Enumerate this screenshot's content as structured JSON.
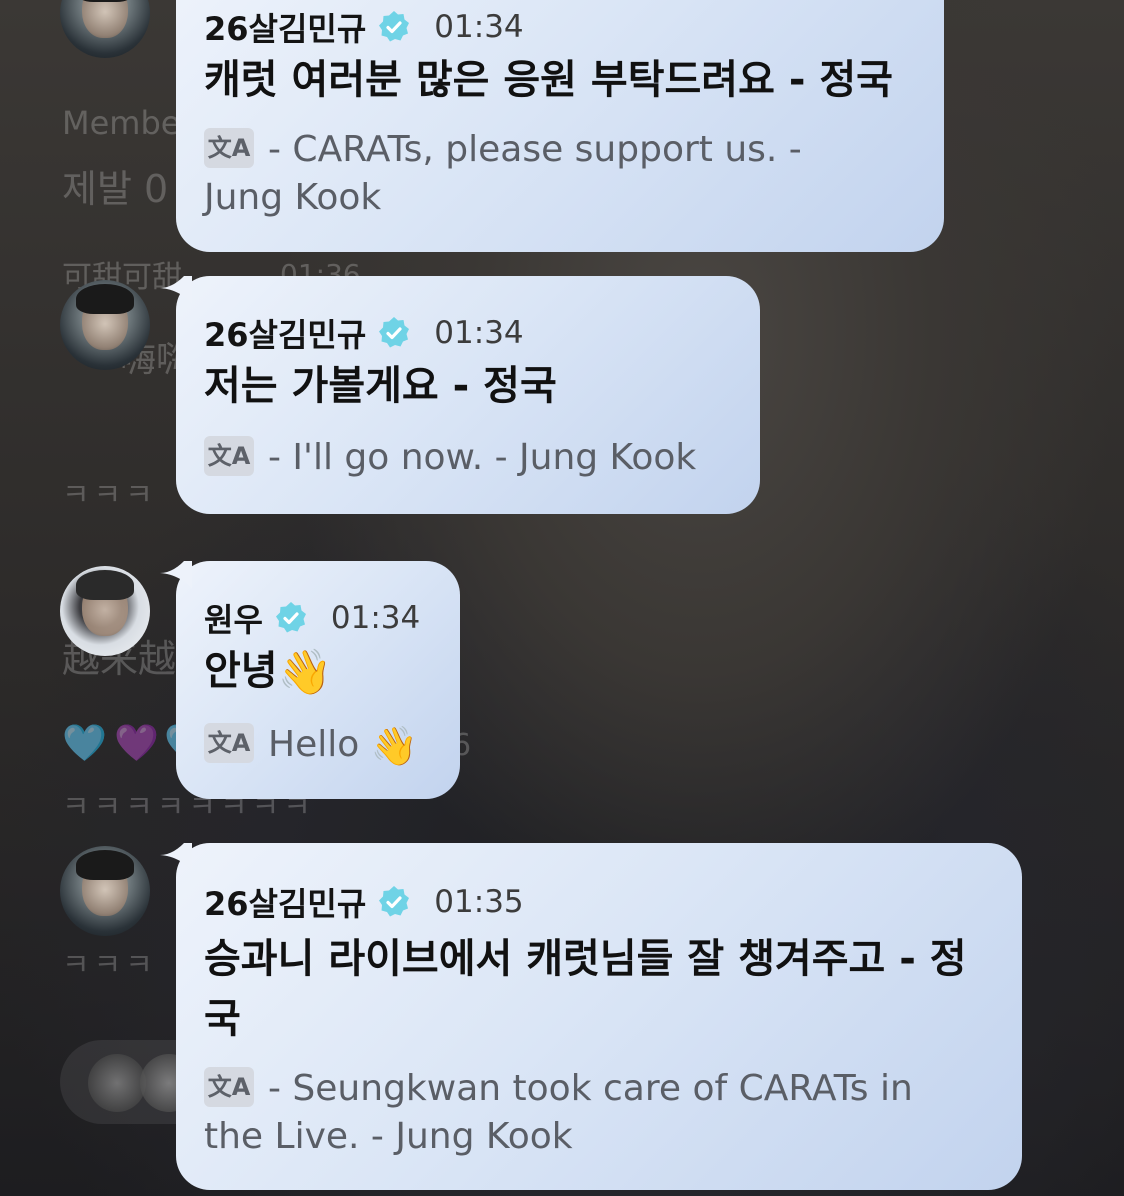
{
  "background_chat": {
    "member_label": "Membe",
    "line_1": "제발 0",
    "line_2": "可甜可甜",
    "line_2_time": "01:36",
    "line_3": "嗨嗨",
    "line_4": "ㅋㅋㅋ",
    "line_5": "越来越",
    "line_6": "ㅋㅋㅋㅋㅋㅋㅋㅋ",
    "line_7": "ㅋㅋㅋ",
    "partial_time": "6",
    "hearts": [
      "🩵",
      "💜",
      "🩵"
    ]
  },
  "messages": [
    {
      "sender": "26살김민규",
      "verified": true,
      "time": "01:34",
      "text": "캐럿 여러분 많은 응원 부탁드려요 - 정국",
      "translation_line_1": "- CARATs, please support us. -",
      "translation_line_2": "Jung Kook",
      "avatar_icon": "profile-photo"
    },
    {
      "sender": "26살김민규",
      "verified": true,
      "time": "01:34",
      "text": "저는 가볼게요 - 정국",
      "translation_line_1": "- I'll go now. - Jung Kook",
      "avatar_icon": "profile-photo"
    },
    {
      "sender": "원우",
      "verified": true,
      "time": "01:34",
      "text": "안녕",
      "emoji": "👋",
      "translation_line_1": "Hello",
      "translation_emoji": "👋",
      "avatar_icon": "profile-photo"
    },
    {
      "sender": "26살김민규",
      "verified": true,
      "time": "01:35",
      "text_line_1": "승과니 라이브에서 캐럿님들 잘 챙겨주고 - 정",
      "text_line_2": "국",
      "translation_line_1": "- Seungkwan took care of CARATs in",
      "translation_line_2": "the Live. - Jung Kook",
      "avatar_icon": "profile-photo"
    }
  ],
  "translate_icon_glyph": "文A",
  "colors": {
    "verified_badge": "#6fd3e6",
    "bubble_start": "#eef3fb",
    "bubble_end": "#c2d3ee"
  }
}
